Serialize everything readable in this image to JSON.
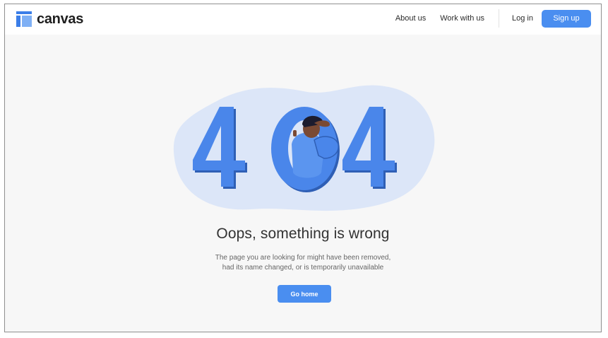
{
  "brand": {
    "name": "canvas",
    "logo_icon": "canvas-layout-icon",
    "accent_color": "#4a8ef0"
  },
  "nav": {
    "about_label": "About us",
    "work_label": "Work with us",
    "login_label": "Log in",
    "signup_label": "Sign up"
  },
  "error": {
    "code": "404",
    "illustration_icon": "person-peeking-404-illustration",
    "title": "Oops, something is wrong",
    "description_line1": "The page you are looking for might have been removed,",
    "description_line2": "had its name changed, or is temporarily unavailable",
    "button_label": "Go home"
  }
}
